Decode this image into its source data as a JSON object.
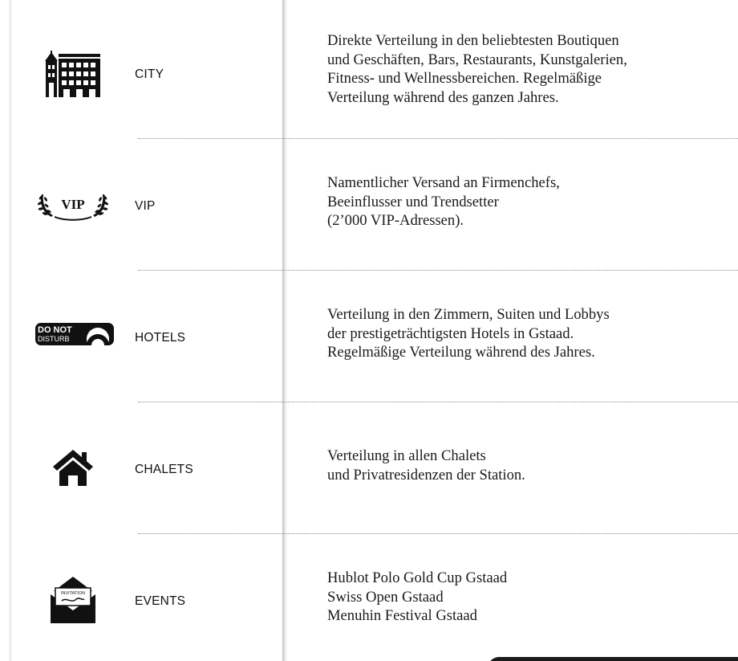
{
  "rows": [
    {
      "label": "CITY",
      "icon": "city-buildings-icon",
      "desc": [
        "Direkte Verteilung in den beliebtesten Boutiquen",
        "und Geschäften, Bars, Restaurants, Kunstgalerien,",
        "Fitness- und Wellnessbereichen. Regelmäßige",
        "Verteilung während des ganzen Jahres."
      ]
    },
    {
      "label": "VIP",
      "icon": "vip-laurel-icon",
      "icon_text": "VIP",
      "desc": [
        "Namentlicher Versand an Firmenchefs,",
        "Beeinflusser und Trendsetter",
        "(2’000 VIP-Adressen)."
      ]
    },
    {
      "label": "HOTELS",
      "icon": "do-not-disturb-sign-icon",
      "icon_text": [
        "DO NOT",
        "DISTURB"
      ],
      "desc": [
        "Verteilung in den Zimmern, Suiten und Lobbys",
        "der prestigeträchtigsten Hotels in Gstaad.",
        "Regelmäßige Verteilung während des Jahres."
      ]
    },
    {
      "label": "CHALETS",
      "icon": "house-icon",
      "desc": [
        "Verteilung in allen Chalets",
        "und Privatresidenzen der Station."
      ]
    },
    {
      "label": "EVENTS",
      "icon": "invitation-envelope-icon",
      "icon_text": "INVITATION",
      "desc": [
        "Hublot Polo Gold Cup Gstaad",
        "Swiss Open Gstaad",
        "Menuhin Festival Gstaad"
      ]
    }
  ],
  "colors": {
    "text": "#111111",
    "icon": "#111111",
    "divider": "#8a8a8a",
    "bottom_tab": "#1b1b1b"
  }
}
